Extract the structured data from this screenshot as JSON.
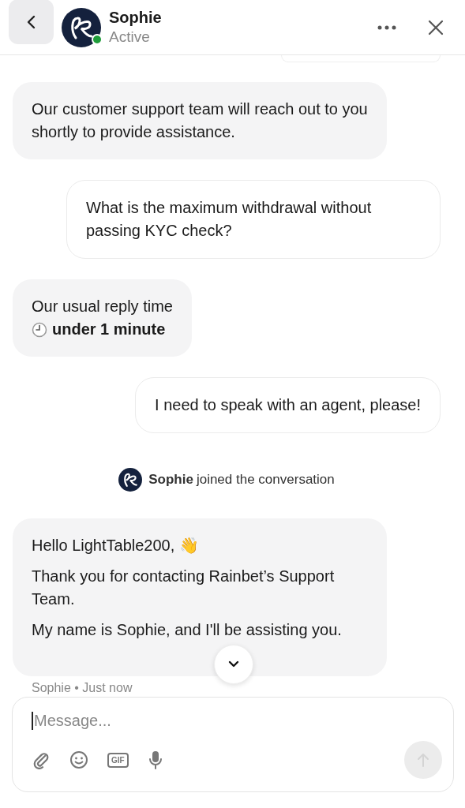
{
  "header": {
    "name": "Sophie",
    "status": "Active",
    "online": true
  },
  "messages": [
    {
      "kind": "cut"
    },
    {
      "kind": "agent",
      "text": "Our customer support team will reach out to you shortly to provide assistance."
    },
    {
      "kind": "user",
      "text": "What is the maximum withdrawal without passing KYC check?"
    },
    {
      "kind": "reply_time",
      "text": "Our usual reply time",
      "time": "under 1 minute"
    },
    {
      "kind": "user",
      "text": "I need to speak with an agent, please!"
    },
    {
      "kind": "system",
      "name": "Sophie",
      "text": "joined the conversation"
    },
    {
      "kind": "agent_multi",
      "paragraphs": [
        "Hello LightTable200, 👋",
        "Thank you for contacting Rainbet’s Support Team.",
        "My name is Sophie, and I'll be assisting you."
      ],
      "meta": "Sophie • Just now"
    }
  ],
  "composer": {
    "placeholder": "Message...",
    "gif": "GIF"
  }
}
